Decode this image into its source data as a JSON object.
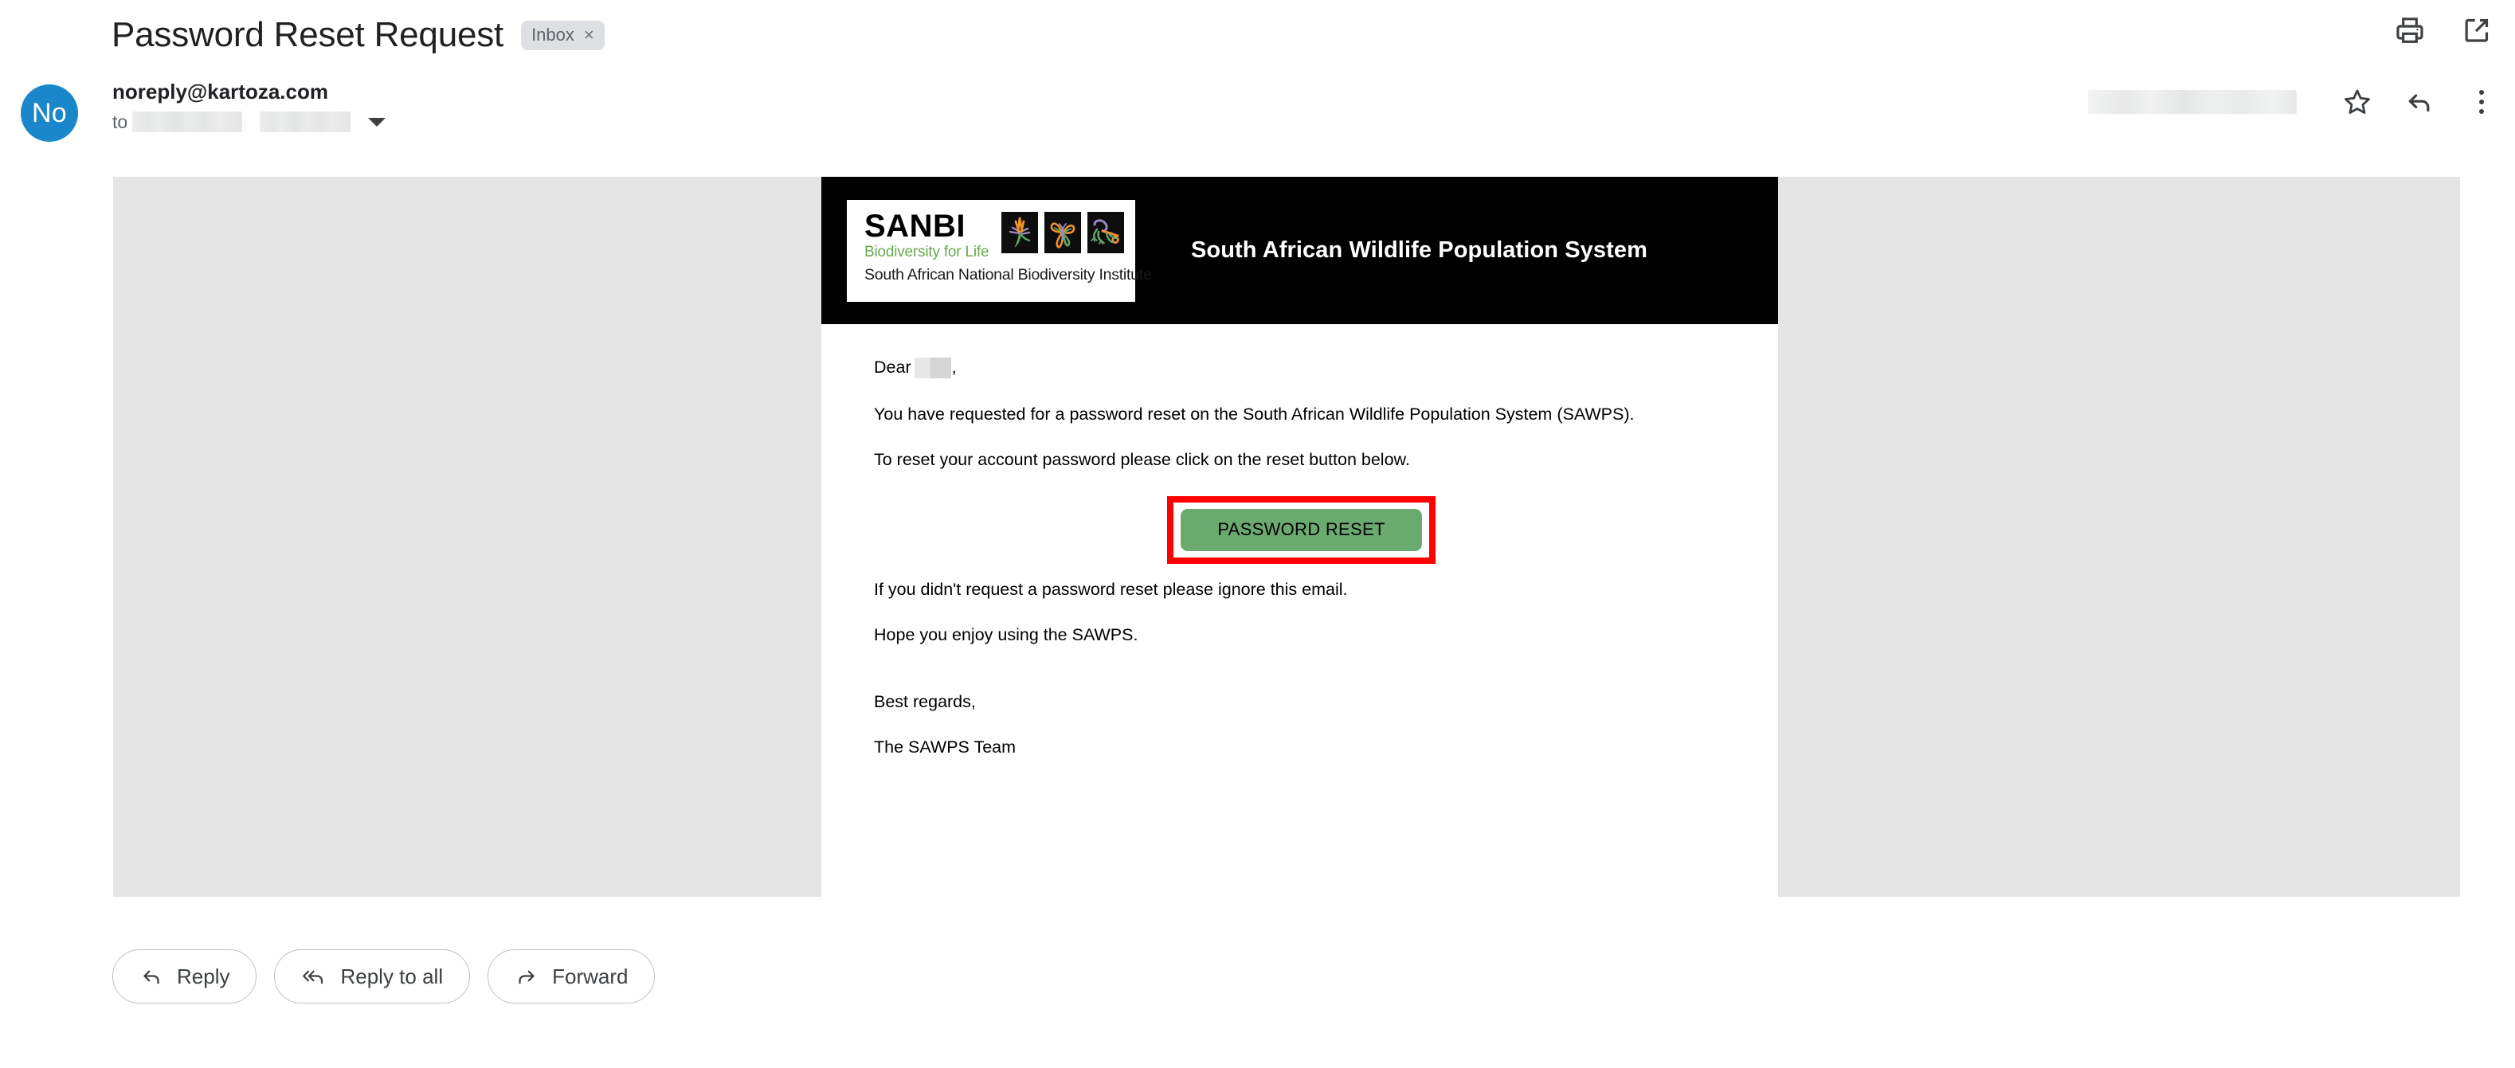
{
  "header": {
    "subject": "Password Reset Request",
    "label_badge": "Inbox",
    "label_badge_close": "×",
    "print_icon": "print-icon",
    "open_in_new_icon": "open-in-new-window-icon"
  },
  "sender": {
    "avatar_initials": "No",
    "email": "noreply@kartoza.com",
    "to_label": "to",
    "recipient_redacted": "",
    "timestamp_redacted": "",
    "star_icon": "star-icon",
    "reply_icon": "reply-arrow-icon",
    "more_icon": "more-options-icon",
    "expand_icon": "chevron-down-icon"
  },
  "email": {
    "banner_title": "South African Wildlife Population System",
    "logo": {
      "wordmark": "SANBI",
      "tagline": "Biodiversity for Life",
      "full_name": "South African National Biodiversity Institute",
      "tiles": [
        "strelitzia-flower-icon",
        "butterfly-icon",
        "gecko-icon"
      ]
    },
    "greeting_prefix": "Dear",
    "greeting_suffix": ",",
    "paragraph_1": "You have requested for a password reset on the South African Wildlife Population System (SAWPS).",
    "paragraph_2": "To reset your account password please click on the reset button below.",
    "reset_button_label": "PASSWORD RESET",
    "paragraph_3": "If you didn't request a password reset please ignore this email.",
    "paragraph_4": "Hope you enjoy using the SAWPS.",
    "signoff": "Best regards,",
    "team": "The SAWPS Team"
  },
  "actions": {
    "reply": "Reply",
    "reply_all": "Reply to all",
    "forward": "Forward"
  },
  "colors": {
    "accent_blue": "#1a87ca",
    "button_green": "#6aaa6f",
    "annotation_red": "#ff0000",
    "banner_black": "#000000",
    "backdrop_gray": "#e5e5e5",
    "logo_green": "#6aa84f"
  }
}
